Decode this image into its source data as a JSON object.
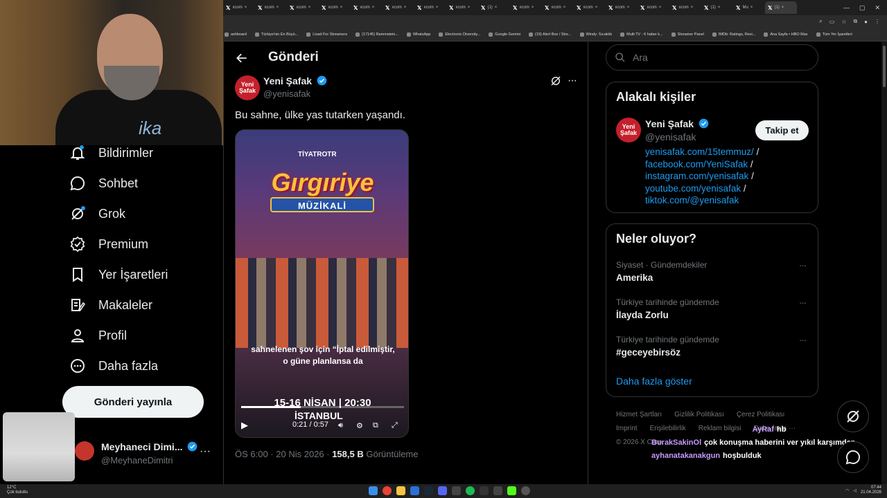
{
  "browser": {
    "tabs": [
      {
        "label": "xcom"
      },
      {
        "label": "xcom"
      },
      {
        "label": "xcom"
      },
      {
        "label": "xcom"
      },
      {
        "label": "xcom"
      },
      {
        "label": "xcom"
      },
      {
        "label": "xcom"
      },
      {
        "label": "xcom"
      },
      {
        "label": "(1)"
      },
      {
        "label": "xcom"
      },
      {
        "label": "xcom"
      },
      {
        "label": "xcom"
      },
      {
        "label": "xcom"
      },
      {
        "label": "xcom"
      },
      {
        "label": "xcom"
      },
      {
        "label": "(1)"
      },
      {
        "label": "Mu"
      },
      {
        "label": "(1)"
      }
    ],
    "bookmarks": [
      "ashboard",
      "Türkiye'nin En Büyü...",
      "Livad For Streamers",
      "(17145) Rammstein...",
      "WhatsApp",
      "Electronic Diversity...",
      "Google Gemini",
      "(19) Alert Box / Stre...",
      "Windy: Sıcaklık",
      "Multi TV - 6 haber k...",
      "Streamer Panel",
      "IMDb: Ratings, Revi...",
      "Ana Sayfa • HBO Max",
      "Tüm Yer İşaretleri"
    ]
  },
  "webcam": {
    "shirt_text": "ika"
  },
  "sidebar": {
    "items": [
      {
        "label": "Bildirimler",
        "icon": "bell-icon"
      },
      {
        "label": "Sohbet",
        "icon": "chat-bubble-icon"
      },
      {
        "label": "Grok",
        "icon": "grok-icon"
      },
      {
        "label": "Premium",
        "icon": "premium-badge-icon"
      },
      {
        "label": "Yer İşaretleri",
        "icon": "bookmark-icon"
      },
      {
        "label": "Makaleler",
        "icon": "article-icon"
      },
      {
        "label": "Profil",
        "icon": "person-icon"
      },
      {
        "label": "Daha fazla",
        "icon": "more-circle-icon"
      }
    ],
    "post_button": "Gönderi yayınla",
    "account": {
      "name": "Meyhaneci Dimi...",
      "handle": "@MeyhaneDimitri",
      "more": "···"
    }
  },
  "main": {
    "title": "Gönderi",
    "author": {
      "name": "Yeni Şafak",
      "handle": "@yenisafak",
      "avatar_text": "Yeni Şafak"
    },
    "text": "Bu sahne, ülke yas tutarken yaşandı.",
    "video": {
      "brand": "TİYATROTR",
      "title": "Gırgıriye",
      "subtitle": "MÜZİKALİ",
      "caption": "sahnelenen şov için “İptal edilmiştir, o güne planlansa da",
      "date_line": "15-16 NİSAN | 20:30",
      "city": "İSTANBUL",
      "time": "0:21 / 0:57",
      "progress": 0.368
    },
    "meta": {
      "time": "ÖS 6:00 · 20 Nis 2026 · ",
      "views": "158,5 B",
      "views_label": " Görüntüleme"
    }
  },
  "right": {
    "search_placeholder": "Ara",
    "related": {
      "title": "Alakalı kişiler",
      "name": "Yeni Şafak",
      "handle": "@yenisafak",
      "follow": "Takip et",
      "links": [
        "yenisafak.com/15temmuz/",
        "facebook.com/YeniSafak",
        "instagram.com/yenisafak",
        "youtube.com/yenisafak",
        "tiktok.com/@yenisafak"
      ],
      "sep": " /"
    },
    "trends": {
      "title": "Neler oluyor?",
      "items": [
        {
          "context": "Siyaset · Gündemdekiler",
          "name": "Amerika"
        },
        {
          "context": "Türkiye tarihinde gündemde",
          "name": "İlayda Zorlu"
        },
        {
          "context": "Türkiye tarihinde gündemde",
          "name": "#geceyebirsöz"
        }
      ],
      "show_more": "Daha fazla göster"
    },
    "footer": {
      "links": [
        "Hizmet Şartları",
        "Gizlilik Politikası",
        "Çerez Politikası",
        "Imprint",
        "Erişilebilirlik",
        "Reklam bilgisi",
        "Daha fazla ···"
      ],
      "copyright": "© 2026 X Corp."
    }
  },
  "chat": [
    {
      "user": "AyRaf",
      "msg": "hb"
    },
    {
      "user": "BurakSakinOl",
      "msg": "çok konuşma haberini ver yıkıl karşımdan"
    },
    {
      "user": "ayhanatakanakgun",
      "msg": "hoşbulduk"
    }
  ],
  "taskbar": {
    "temp": "12°C",
    "weather": "Çok bulutlu",
    "time": "07:44",
    "date": "21.04.2026"
  },
  "colors": {
    "accent": "#1d9bf0",
    "border": "#2f3336",
    "muted": "#71767b"
  }
}
